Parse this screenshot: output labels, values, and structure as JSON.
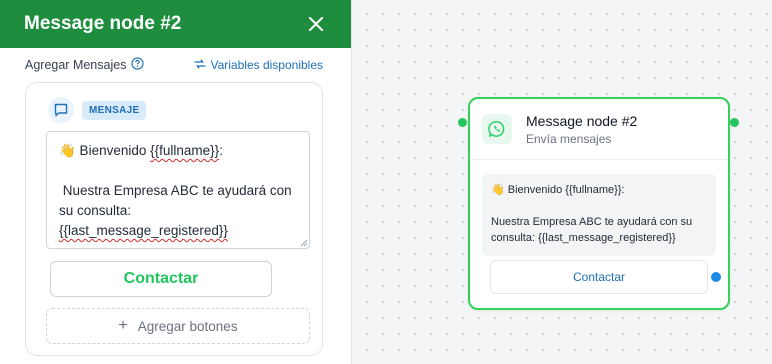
{
  "panel": {
    "title": "Message node #2",
    "section_label": "Agregar Mensajes",
    "variables_link": "Variables disponibles",
    "badge": "MENSAJE",
    "message_text": "👋 Bienvenido {{fullname}}:\n\n Nuestra Empresa ABC te ayudará con su consulta: {{last_message_registered}}",
    "button_label": "Contactar",
    "add_buttons_label": "Agregar botones"
  },
  "node": {
    "title": "Message node #2",
    "subtitle": "Envía mensajes",
    "message_text": "👋 Bienvenido {{fullname}}:\n\nNuestra Empresa ABC te ayudará con su consulta: {{last_message_registered}}",
    "button_label": "Contactar"
  },
  "colors": {
    "header_green": "#1e8e3e",
    "node_border": "#34d058",
    "link_blue": "#1d6fb8",
    "button_green": "#22c55e"
  },
  "icons": [
    "close-icon",
    "help-icon",
    "variables-icon",
    "chat-bubble-icon",
    "plus-icon",
    "whatsapp-icon"
  ]
}
